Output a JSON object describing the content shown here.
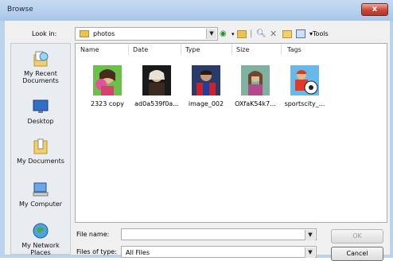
{
  "window": {
    "title": "Browse",
    "close_label": "x"
  },
  "look_in": {
    "label": "Look in:",
    "value": "photos"
  },
  "places": [
    {
      "label": "My Recent Documents"
    },
    {
      "label": "Desktop"
    },
    {
      "label": "My Documents"
    },
    {
      "label": "My Computer"
    },
    {
      "label": "My Network Places"
    }
  ],
  "columns": [
    "Name",
    "Date",
    "Type",
    "Size",
    "Tags"
  ],
  "toolbar": {
    "tools_label": "Tools"
  },
  "files": [
    {
      "name": "2323 copy"
    },
    {
      "name": "ad0a539f0a..."
    },
    {
      "name": "image_002"
    },
    {
      "name": "OXfaK54k7..."
    },
    {
      "name": "sportscity_..."
    }
  ],
  "file_name": {
    "label": "File name:",
    "value": ""
  },
  "file_type": {
    "label": "Files of type:",
    "value": "All Files"
  },
  "buttons": {
    "ok": "OK",
    "cancel": "Cancel"
  }
}
